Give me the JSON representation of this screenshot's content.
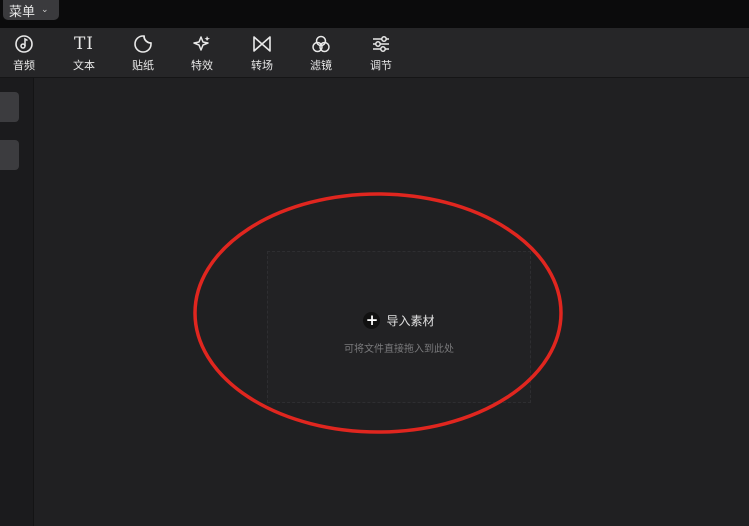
{
  "menu": {
    "label": "菜单"
  },
  "toolbar": {
    "items": [
      {
        "label": "音频",
        "icon": "music-note-icon"
      },
      {
        "label": "文本",
        "icon": "text-ti-icon",
        "glyph": "TI"
      },
      {
        "label": "贴纸",
        "icon": "sticker-icon"
      },
      {
        "label": "特效",
        "icon": "sparkle-star-icon"
      },
      {
        "label": "转场",
        "icon": "bowtie-transition-icon"
      },
      {
        "label": "滤镜",
        "icon": "filter-circles-icon"
      },
      {
        "label": "调节",
        "icon": "sliders-icon"
      }
    ]
  },
  "dropzone": {
    "import_label": "导入素材",
    "hint": "可将文件直接拖入到此处"
  },
  "colors": {
    "annotation_ring": "#e0261f",
    "background": "#1f1f21"
  }
}
